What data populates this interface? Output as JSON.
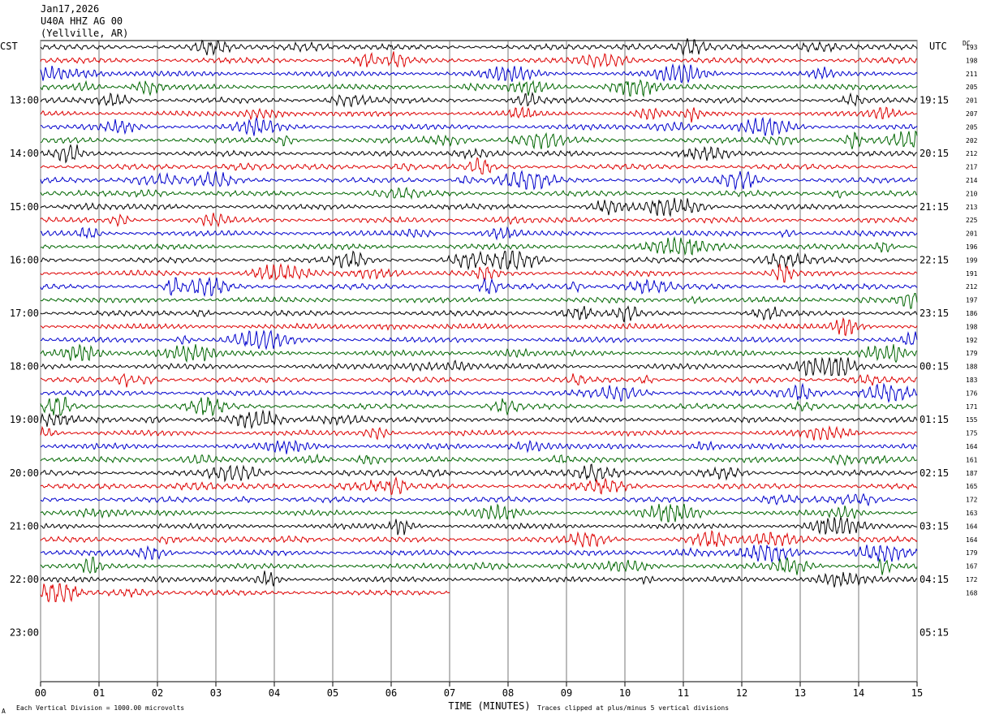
{
  "header": {
    "date": "Jan17,2026",
    "station": "U40A HHZ AG 00",
    "location": "(Yellville, AR)"
  },
  "chart_data": {
    "type": "line",
    "left_axis_label": "CST",
    "right_axis_label": "UTC",
    "dc_label": "DC",
    "left_hours": [
      "13:00",
      "14:00",
      "15:00",
      "16:00",
      "17:00",
      "18:00",
      "19:00",
      "20:00",
      "21:00",
      "22:00",
      "23:00"
    ],
    "right_hours": [
      "19:15",
      "20:15",
      "21:15",
      "22:15",
      "23:15",
      "00:15",
      "01:15",
      "02:15",
      "03:15",
      "04:15",
      "05:15"
    ],
    "x_ticks": [
      "00",
      "01",
      "02",
      "03",
      "04",
      "05",
      "06",
      "07",
      "08",
      "09",
      "10",
      "11",
      "12",
      "13",
      "14",
      "15"
    ],
    "xlim": [
      0,
      15
    ],
    "xlabel": "TIME (MINUTES)",
    "dc_offsets": [
      193,
      198,
      211,
      205,
      201,
      207,
      205,
      202,
      212,
      217,
      214,
      210,
      213,
      225,
      201,
      196,
      199,
      191,
      212,
      197,
      186,
      198,
      192,
      179,
      188,
      183,
      176,
      171,
      155,
      175,
      164,
      161,
      187,
      165,
      172,
      163,
      164,
      164,
      179,
      167,
      172,
      168
    ],
    "trace_colors": [
      "#000000",
      "#dd0000",
      "#0000cc",
      "#006600"
    ],
    "last_trace_end_minute": 7,
    "footer_left": "Each Vertical Division = 1000.00 microvolts",
    "footer_right": "Traces clipped at plus/minus 5 vertical divisions",
    "footer_mark": "A"
  }
}
